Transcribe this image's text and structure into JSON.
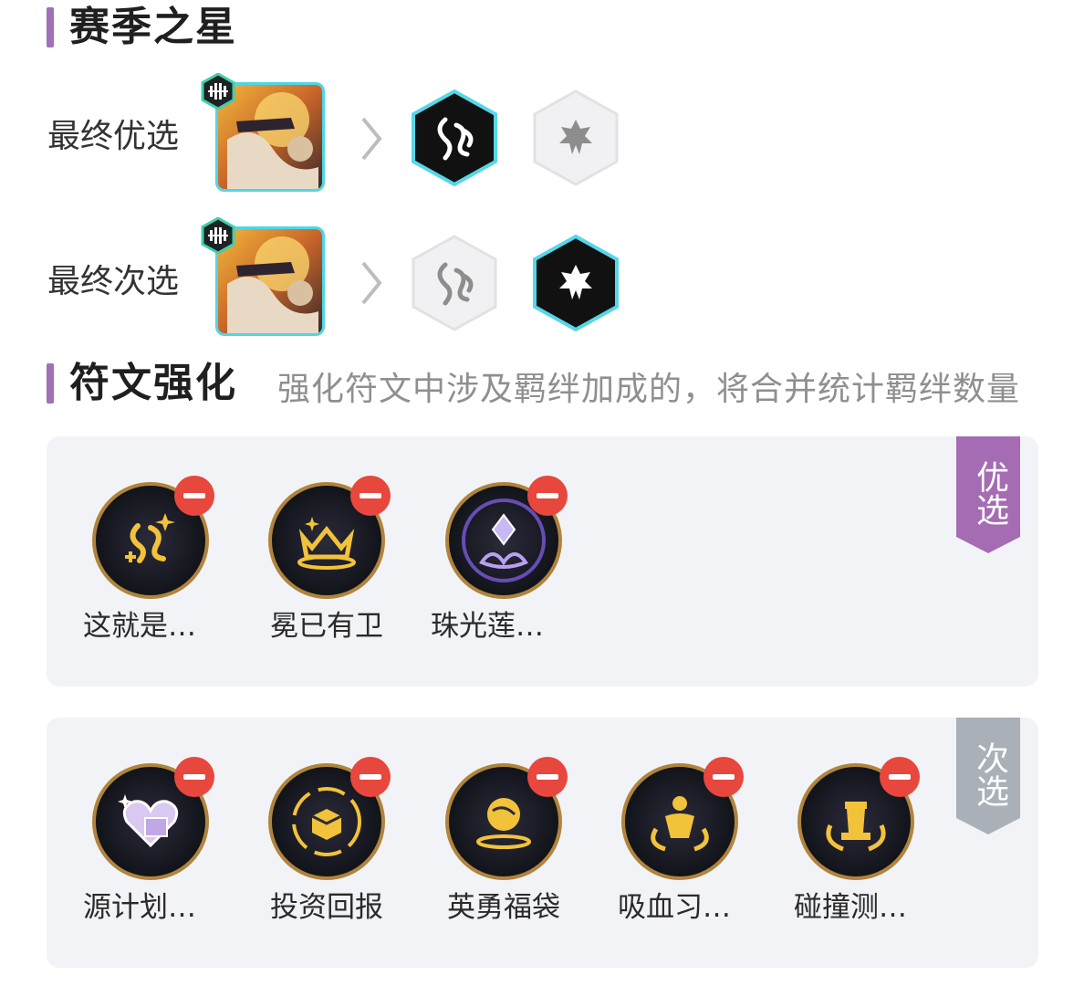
{
  "season_star": {
    "title": "赛季之星",
    "rows": [
      {
        "label": "最终优选"
      },
      {
        "label": "最终次选"
      }
    ]
  },
  "rune_section": {
    "title": "符文强化",
    "subtitle": "强化符文中涉及羁绊加成的，将合并统计羁绊数量"
  },
  "preferred": {
    "tag": "优选",
    "tag_color": "#a56cb3",
    "items": [
      {
        "name": "这就是…",
        "icon": "music-note-plus-icon"
      },
      {
        "name": "冕已有卫",
        "icon": "crown-icon"
      },
      {
        "name": "珠光莲…",
        "icon": "crystal-lotus-icon"
      }
    ]
  },
  "secondary": {
    "tag": "次选",
    "tag_color": "#a9b0b8",
    "items": [
      {
        "name": "源计划…",
        "icon": "heart-box-icon"
      },
      {
        "name": "投资回报",
        "icon": "treasure-box-icon"
      },
      {
        "name": "英勇福袋",
        "icon": "golden-orb-icon"
      },
      {
        "name": "吸血习…",
        "icon": "vampire-figure-icon"
      },
      {
        "name": "碰撞测…",
        "icon": "chess-piece-icon"
      }
    ]
  },
  "colors": {
    "accent": "#a070b8",
    "cyan_border": "#4fd6e6",
    "remove_red": "#e8473e",
    "rune_ring": "#b0843c"
  }
}
